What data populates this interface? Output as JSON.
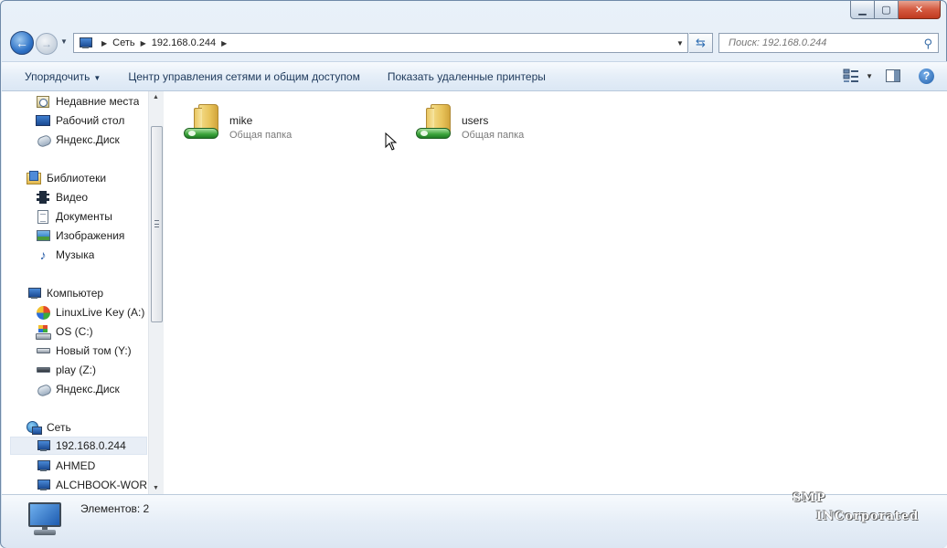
{
  "address": {
    "crumbs": [
      "Сеть",
      "192.168.0.244"
    ]
  },
  "search": {
    "placeholder": "Поиск: 192.168.0.244"
  },
  "toolbar": {
    "organize": "Упорядочить",
    "network_center": "Центр управления сетями и общим доступом",
    "show_printers": "Показать удаленные принтеры"
  },
  "nav": {
    "favorites": [
      {
        "label": "Недавние места",
        "icon": "recent-places-icon"
      },
      {
        "label": "Рабочий стол",
        "icon": "desktop-icon"
      },
      {
        "label": "Яндекс.Диск",
        "icon": "yandex-disk-icon"
      }
    ],
    "libraries": {
      "label": "Библиотеки",
      "items": [
        {
          "label": "Видео",
          "icon": "video-icon"
        },
        {
          "label": "Документы",
          "icon": "documents-icon"
        },
        {
          "label": "Изображения",
          "icon": "images-icon"
        },
        {
          "label": "Музыка",
          "icon": "music-icon"
        }
      ]
    },
    "computer": {
      "label": "Компьютер",
      "items": [
        {
          "label": "LinuxLive Key (A:)",
          "icon": "linuxlive-drive-icon"
        },
        {
          "label": "OS (C:)",
          "icon": "system-drive-icon"
        },
        {
          "label": "Новый том (Y:)",
          "icon": "hard-drive-icon"
        },
        {
          "label": "play (Z:)",
          "icon": "network-drive-icon"
        },
        {
          "label": "Яндекс.Диск",
          "icon": "yandex-disk-icon"
        }
      ]
    },
    "network": {
      "label": "Сеть",
      "items": [
        {
          "label": "192.168.0.244",
          "icon": "network-computer-icon",
          "selected": true
        },
        {
          "label": "AHMED",
          "icon": "network-computer-icon"
        },
        {
          "label": "ALCHBOOK-WORK",
          "icon": "network-computer-icon"
        }
      ]
    }
  },
  "content": {
    "folders": [
      {
        "name": "mike",
        "type": "Общая папка"
      },
      {
        "name": "users",
        "type": "Общая папка"
      }
    ]
  },
  "status": {
    "items_count": "Элементов: 2"
  },
  "watermark": {
    "line1": "SMP",
    "line2": "INCorporated"
  }
}
